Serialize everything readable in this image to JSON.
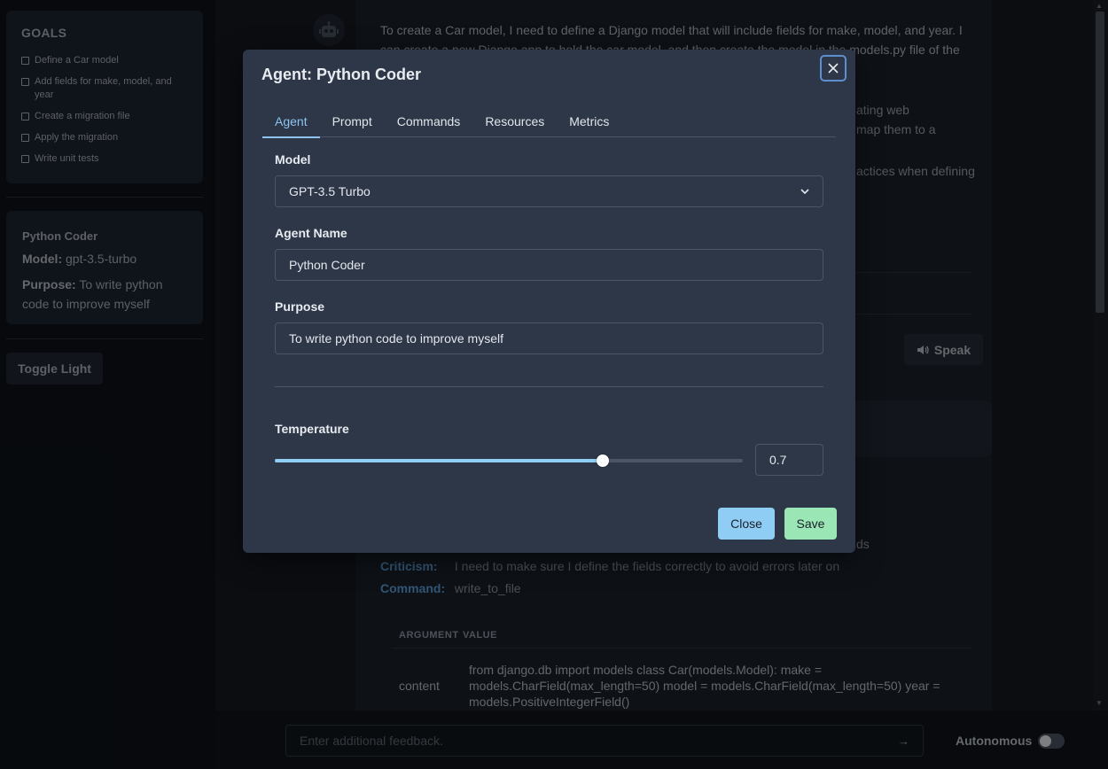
{
  "sidebar": {
    "goals_title": "GOALS",
    "goals": [
      "Define a Car model",
      "Add fields for make, model, and year",
      "Create a migration file",
      "Apply the migration",
      "Write unit tests"
    ],
    "agent_card": {
      "name": "Python Coder",
      "model_label": "Model:",
      "model_value": "gpt-3.5-turbo",
      "purpose_label": "Purpose:",
      "purpose_value": "To write python code to improve myself"
    },
    "toggle_light_label": "Toggle Light"
  },
  "main": {
    "message_text": "To create a Car model, I need to define a Django model that will include fields for make, model, and year. I can create a new Django app to hold the car model, and then create the model in the models.py file of the",
    "frag1": "ating web",
    "frag2": "map them to a",
    "frag3": "actices when defining",
    "frag4": "ds",
    "speak_label": "Speak",
    "criticism_label": "Criticism:",
    "criticism_value": "I need to make sure I define the fields correctly to avoid errors later on",
    "command_label": "Command:",
    "command_value": "write_to_file",
    "args_header_argument": "ARGUMENT",
    "args_header_value": "VALUE",
    "args_row_argument": "content",
    "args_row_value": "from django.db import models class Car(models.Model): make = models.CharField(max_length=50) model = models.CharField(max_length=50) year = models.PositiveIntegerField()"
  },
  "footer": {
    "feedback_placeholder": "Enter additional feedback.",
    "autonomous_label": "Autonomous",
    "autonomous_on": false
  },
  "modal": {
    "title": "Agent: Python Coder",
    "tabs": [
      "Agent",
      "Prompt",
      "Commands",
      "Resources",
      "Metrics"
    ],
    "active_tab": "Agent",
    "model_label": "Model",
    "model_value": "GPT-3.5 Turbo",
    "agent_name_label": "Agent Name",
    "agent_name_value": "Python Coder",
    "purpose_label": "Purpose",
    "purpose_value": "To write python code to improve myself",
    "temperature_label": "Temperature",
    "temperature_value": "0.7",
    "close_label": "Close",
    "save_label": "Save"
  },
  "colors": {
    "accent_blue": "#90cdf4",
    "accent_green": "#9ae6b4",
    "modal_bg": "#2d3748",
    "link_blue": "#5b9bd5"
  }
}
